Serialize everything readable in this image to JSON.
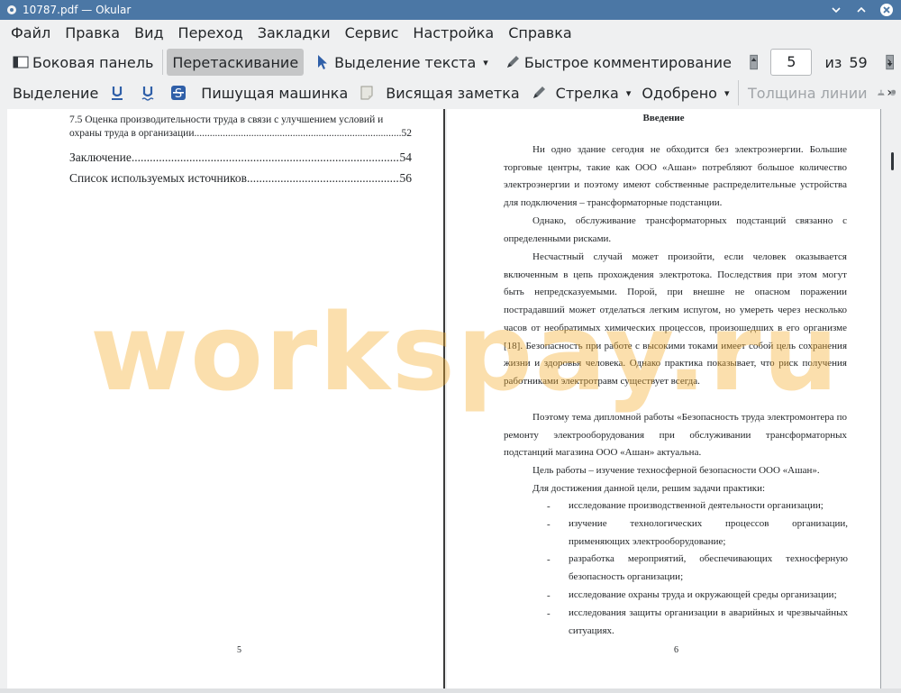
{
  "window": {
    "title": "10787.pdf  — Okular"
  },
  "menu": [
    "Файл",
    "Правка",
    "Вид",
    "Переход",
    "Закладки",
    "Сервис",
    "Настройка",
    "Справка"
  ],
  "toolbar1": {
    "sidebar": "Боковая панель",
    "drag": "Перетаскивание",
    "text_select": "Выделение текста",
    "quick_comment": "Быстрое комментирование",
    "page_current": "5",
    "page_of": "из",
    "page_total": "59"
  },
  "toolbar2": {
    "select": "Выделение",
    "typewriter": "Пишущая машинка",
    "sticky_note": "Висящая заметка",
    "arrow": "Стрелка",
    "approved": "Одобрено",
    "line_width": "Толщина линии"
  },
  "page5": {
    "toc": [
      {
        "text": "7.5 Оценка производительности труда в связи с улучшением условий и",
        "page": ""
      },
      {
        "text": "охраны труда в организации",
        "page": "52"
      },
      {
        "text": "Заключение",
        "page": "54"
      },
      {
        "text": "Список используемых источников",
        "page": "56"
      }
    ],
    "number": "5"
  },
  "page6": {
    "heading": "Введение",
    "paragraphs": [
      "Ни одно здание сегодня не обходится без электроэнергии. Большие торговые центры, такие как ООО «Ашан» потребляют большое количество электроэнергии и поэтому имеют собственные распределительные устройства для подключения – трансформаторные подстанции.",
      "Однако, обслуживание трансформаторных подстанций связанно с определенными рисками.",
      "Несчастный случай может произойти, если человек оказывается включенным в цепь прохождения электротока. Последствия при этом могут быть непредсказуемыми. Порой, при внешне не опасном поражении пострадавший может отделаться легким испугом, но умереть через несколько часов от необратимых химических процессов, произошедших в его организме [18]. Безопасность при работе с высокими токами имеет собой цель сохранения жизни и здоровья человека. Однако практика показывает, что риск получения работниками электротравм существует всегда.",
      "Поэтому тема дипломной работы «Безопасность труда электромонтера по ремонту электрооборудования при обслуживании трансформаторных подстанций магазина ООО «Ашан» актуальна.",
      "Цель работы – изучение техносферной безопасности ООО «Ашан».",
      "Для достижения данной цели, решим задачи практики:"
    ],
    "list": [
      "исследование производственной деятельности организации;",
      "изучение технологических процессов организации, применяющих электрооборудование;",
      "разработка мероприятий, обеспечивающих техносферную безопасность организации;",
      "исследование охраны труда и окружающей среды организации;",
      "исследования защиты организации в аварийных и чрезвычайных ситуациях."
    ],
    "number": "6"
  },
  "watermark": "workspay.ru",
  "colors": {
    "titlebar": "#4b77a5",
    "window_bg": "#eff0f1",
    "active_button": "#c5c6c7",
    "watermark": "#f5aa28"
  },
  "icons": [
    "okular-app-icon",
    "minimize-icon",
    "maximize-icon",
    "close-icon",
    "sidebar-icon",
    "cursor-icon",
    "pen-icon",
    "page-up-icon",
    "page-down-icon",
    "underline-icon",
    "strikeout-icon",
    "note-icon",
    "stamp-icon"
  ]
}
